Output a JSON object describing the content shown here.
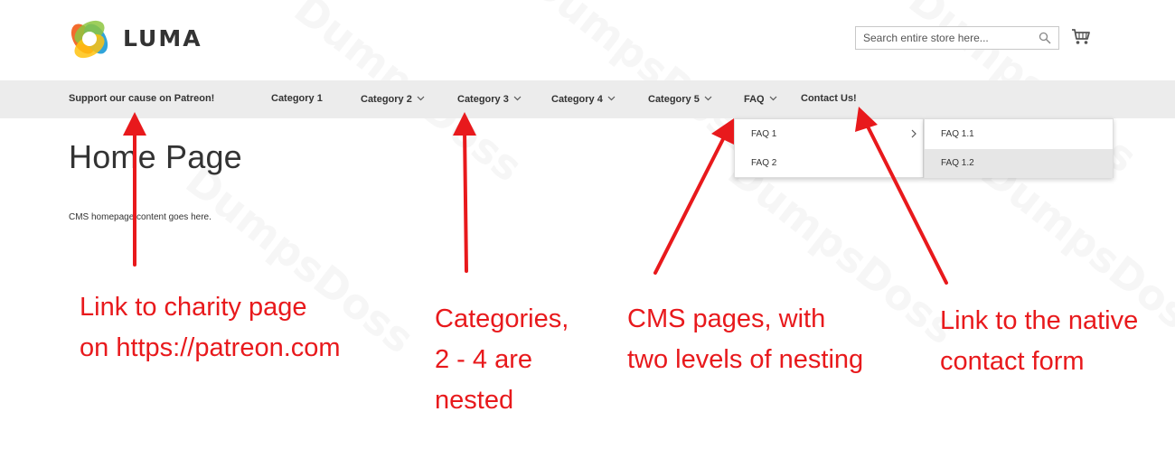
{
  "header": {
    "brand": "LUMA",
    "search_placeholder": "Search entire store here...",
    "logo_icon": "luma-logo",
    "cart_icon": "cart-icon",
    "search_icon": "magnifier-icon"
  },
  "nav": {
    "items": [
      {
        "label": "Support our cause on Patreon!",
        "has_children": false
      },
      {
        "label": "Category 1",
        "has_children": false
      },
      {
        "label": "Category 2",
        "has_children": true
      },
      {
        "label": "Category 3",
        "has_children": true
      },
      {
        "label": "Category 4",
        "has_children": true
      },
      {
        "label": "Category 5",
        "has_children": true
      },
      {
        "label": "FAQ",
        "has_children": true
      },
      {
        "label": "Contact Us!",
        "has_children": false
      }
    ]
  },
  "faq_menu": {
    "items": [
      "FAQ 1",
      "FAQ 2"
    ],
    "submenu": [
      "FAQ 1.1",
      "FAQ 1.2"
    ]
  },
  "content": {
    "title": "Home Page",
    "body": "CMS homepage content goes here."
  },
  "annotations": {
    "patreon": [
      "Link to charity page",
      "on https://patreon.com"
    ],
    "categories": [
      "Categories,",
      "2 - 4 are",
      "nested"
    ],
    "cms": [
      "CMS pages, with",
      "two levels of nesting"
    ],
    "contact": [
      "Link to the native",
      "contact form"
    ]
  },
  "watermark": "DumpsDoss",
  "colors": {
    "annotation": "#e8191c",
    "nav_bar": "#ececec",
    "logo_orange": "#f26322",
    "logo_blue": "#1a9ad6",
    "logo_green": "#8dc63f",
    "logo_yellow": "#ffc20e"
  }
}
